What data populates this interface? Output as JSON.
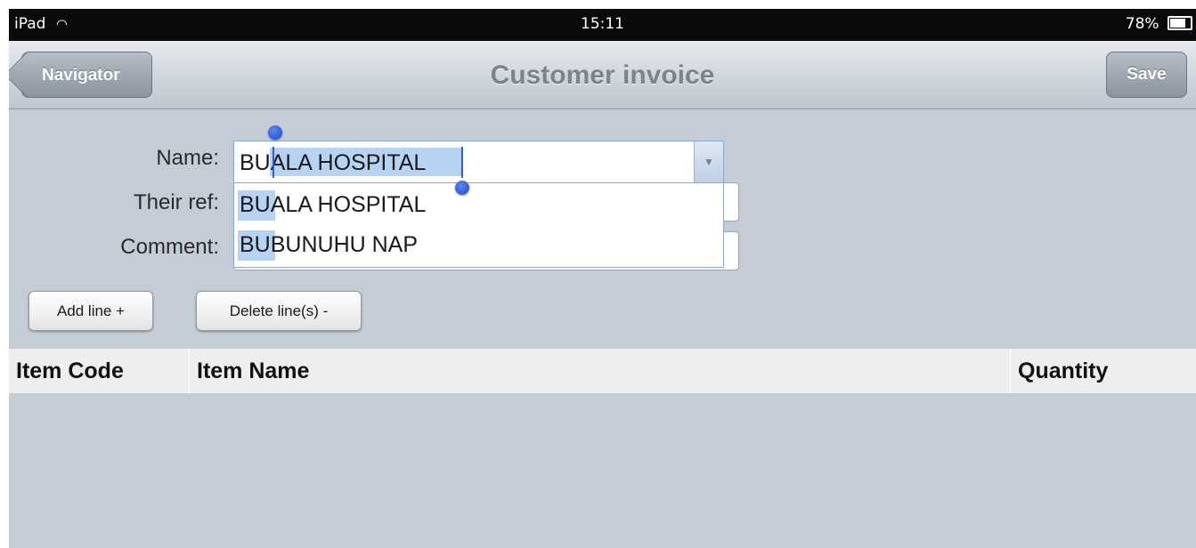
{
  "status_bar": {
    "device": "iPad",
    "wifi_icon": "wifi-icon",
    "time": "15:11",
    "battery": "78%",
    "battery_icon": "battery-icon"
  },
  "nav": {
    "back_label": "Navigator",
    "title": "Customer invoice",
    "save_label": "Save"
  },
  "form": {
    "name_label": "Name:",
    "name_value": "BUALA HOSPITAL",
    "their_ref_label": "Their ref:",
    "comment_label": "Comment:",
    "suggestions": [
      {
        "match": "BU",
        "rest": "ALA HOSPITAL",
        "full": "BUALA HOSPITAL"
      },
      {
        "match": "BU",
        "rest": "BUNUHU NAP",
        "full": "BUBUNUHU NAP"
      }
    ]
  },
  "actions": {
    "add_line": "Add line +",
    "delete_lines": "Delete line(s) -"
  },
  "table": {
    "columns": [
      "Item Code",
      "Item Name",
      "Quantity"
    ],
    "rows": []
  },
  "colors": {
    "background": "#c4ccd6",
    "selection": "#b7d3f3",
    "caret": "#2f5fd6"
  }
}
